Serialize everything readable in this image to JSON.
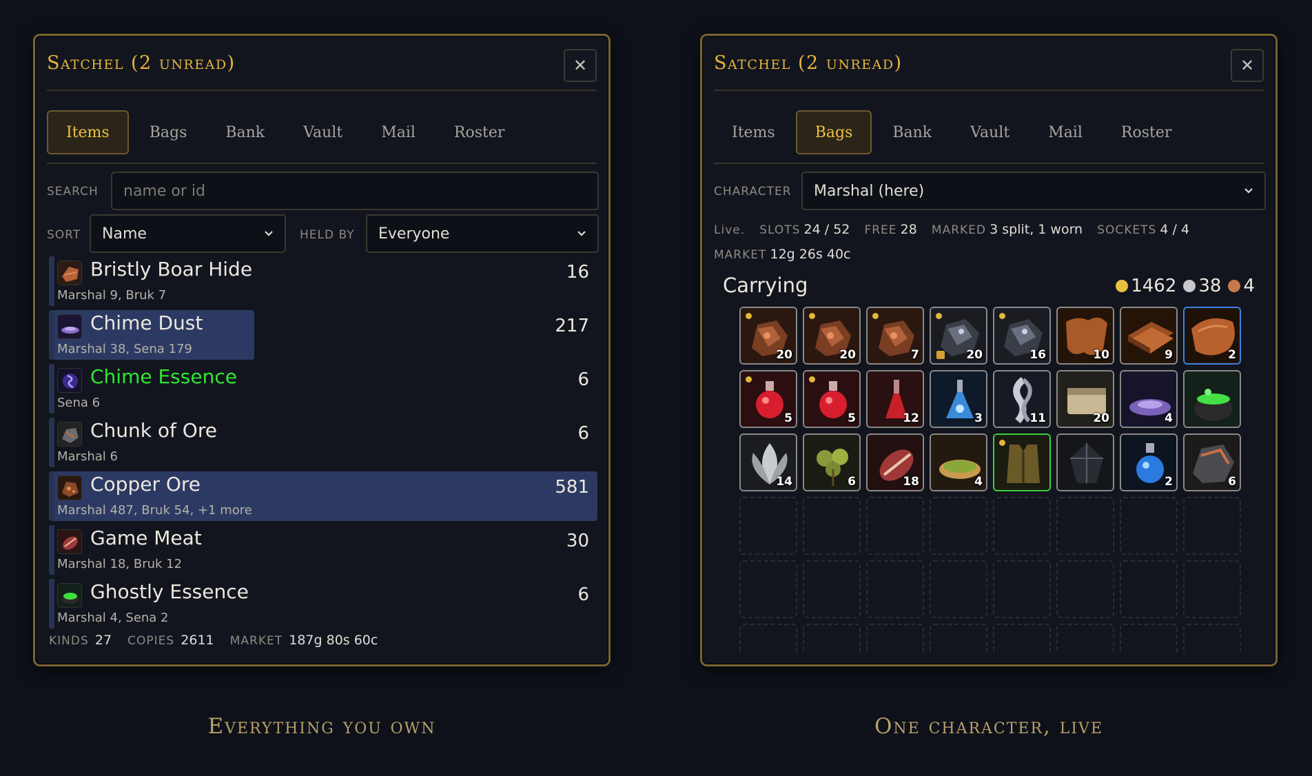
{
  "left": {
    "title": "Satchel (2 unread)",
    "close_label": "✕",
    "tabs": [
      "Items",
      "Bags",
      "Bank",
      "Vault",
      "Mail",
      "Roster"
    ],
    "active_tab": "Items",
    "search": {
      "label": "SEARCH",
      "placeholder": "name or id"
    },
    "sort": {
      "label": "SORT",
      "value": "Name"
    },
    "held_by": {
      "label": "HELD BY",
      "value": "Everyone"
    },
    "items": [
      {
        "name": "Bristly Boar Hide",
        "holders": "Marshal 9, Bruk 7",
        "qty": "16",
        "icon": "hide-icon"
      },
      {
        "name": "Chime Dust",
        "holders": "Marshal 38, Sena 179",
        "qty": "217",
        "icon": "dust-icon",
        "partial_fill": 0.31
      },
      {
        "name": "Chime Essence",
        "holders": "Sena 6",
        "qty": "6",
        "icon": "essence-icon",
        "name_color": "#2ee82e"
      },
      {
        "name": "Chunk of Ore",
        "holders": "Marshal 6",
        "qty": "6",
        "icon": "ore-icon"
      },
      {
        "name": "Copper Ore",
        "holders": "Marshal 487, Bruk 54, +1 more",
        "qty": "581",
        "icon": "copper-ore-icon",
        "selected": true
      },
      {
        "name": "Game Meat",
        "holders": "Marshal 18, Bruk 12",
        "qty": "30",
        "icon": "meat-icon"
      },
      {
        "name": "Ghostly Essence",
        "holders": "Marshal 4, Sena 2",
        "qty": "6",
        "icon": "ghost-essence-icon"
      }
    ],
    "footer": {
      "kinds_label": "KINDS",
      "kinds": "27",
      "copies_label": "COPIES",
      "copies": "2611",
      "market_label": "MARKET",
      "market": "187g 80s 60c"
    },
    "caption": "Everything you own"
  },
  "right": {
    "title": "Satchel (2 unread)",
    "close_label": "✕",
    "tabs": [
      "Items",
      "Bags",
      "Bank",
      "Vault",
      "Mail",
      "Roster"
    ],
    "active_tab": "Bags",
    "character": {
      "label": "CHARACTER",
      "value": "Marshal (here)"
    },
    "stats": {
      "live": "Live.",
      "slots_label": "SLOTS",
      "slots": "24 / 52",
      "free_label": "FREE",
      "free": "28",
      "marked_label": "MARKED",
      "marked": "3 split, 1 worn",
      "sockets_label": "SOCKETS",
      "sockets": "4 / 4",
      "market_label": "MARKET",
      "market": "12g 26s 40c"
    },
    "carrying": {
      "title": "Carrying",
      "gold": "1462",
      "silver": "38",
      "copper": "4"
    },
    "slots": [
      {
        "icon": "copper-ore-icon",
        "count": "20",
        "marked": true
      },
      {
        "icon": "copper-ore-icon",
        "count": "20",
        "marked": true
      },
      {
        "icon": "copper-ore-icon",
        "count": "7",
        "marked": true
      },
      {
        "icon": "coal-ore-icon",
        "count": "20",
        "marked": true,
        "locked": true
      },
      {
        "icon": "coal-ore-icon",
        "count": "16",
        "marked": true
      },
      {
        "icon": "leather-icon",
        "count": "10"
      },
      {
        "icon": "leather-stack-icon",
        "count": "9"
      },
      {
        "icon": "hide-icon",
        "count": "2",
        "border": "blue"
      },
      {
        "icon": "health-potion-icon",
        "count": "5",
        "marked": true
      },
      {
        "icon": "health-potion-icon",
        "count": "5",
        "marked": true
      },
      {
        "icon": "red-flask-icon",
        "count": "12"
      },
      {
        "icon": "blue-flask-icon",
        "count": "3"
      },
      {
        "icon": "silk-cloth-icon",
        "count": "11"
      },
      {
        "icon": "linen-cloth-icon",
        "count": "20"
      },
      {
        "icon": "dust-icon",
        "count": "4"
      },
      {
        "icon": "ghost-cauldron-icon",
        "count": ""
      },
      {
        "icon": "silverleaf-icon",
        "count": "14"
      },
      {
        "icon": "herb-icon",
        "count": "6"
      },
      {
        "icon": "meat-icon",
        "count": "18"
      },
      {
        "icon": "bread-icon",
        "count": "4"
      },
      {
        "icon": "vest-icon",
        "count": "",
        "border": "green",
        "marked": true
      },
      {
        "icon": "dark-gem-icon",
        "count": ""
      },
      {
        "icon": "mana-potion-icon",
        "count": "2"
      },
      {
        "icon": "stone-ore-icon",
        "count": "6"
      }
    ],
    "caption": "One character, live"
  },
  "colors": {
    "accent_gold": "#e6b53b",
    "selected_row": "#2c3a63",
    "panel_border": "#7a6530",
    "rare_green": "#2ee82e"
  }
}
